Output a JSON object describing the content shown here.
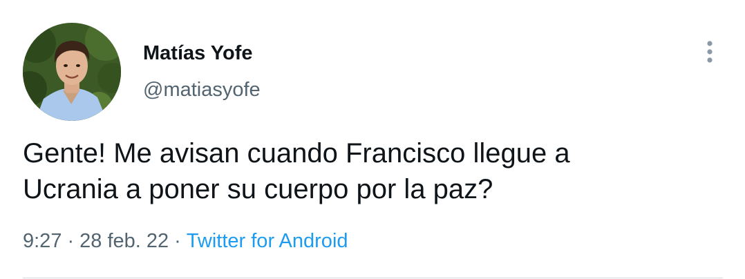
{
  "author": {
    "display_name": "Matías Yofe",
    "handle": "@matiasyofe",
    "avatar_icon": "profile-photo"
  },
  "tweet": {
    "text_lines": [
      "Gente! Me avisan cuando Francisco llegue a",
      "Ucrania a poner su cuerpo por la paz?"
    ],
    "time": "9:27",
    "date": "28 feb. 22",
    "separator": "·",
    "source": "Twitter for Android"
  },
  "menu": {
    "icon": "more-vertical-icon"
  },
  "colors": {
    "text": "#0f1419",
    "secondary": "#536471",
    "link": "#1d9bf0",
    "divider": "#cfd9de"
  }
}
